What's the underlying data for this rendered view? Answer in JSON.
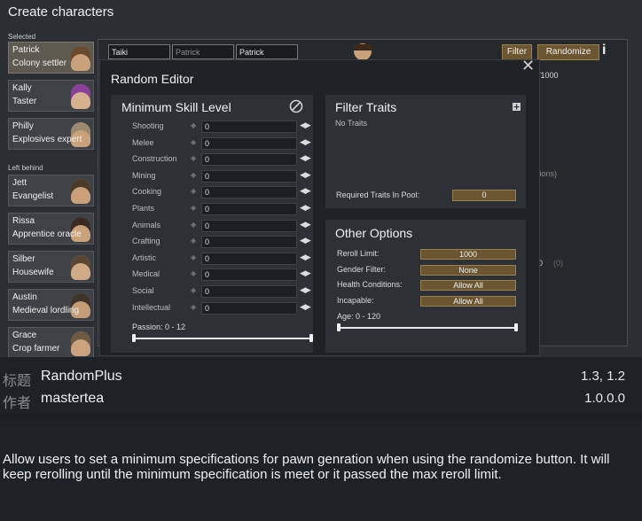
{
  "window": {
    "title": "Create characters"
  },
  "sections": {
    "selected": "Selected",
    "left_behind": "Left behind"
  },
  "pawns_selected": [
    {
      "name": "Patrick",
      "title": "Colony settler",
      "hair": "#6a4a2e",
      "skin": "#c9a27c"
    },
    {
      "name": "Kally",
      "title": "Taster",
      "hair": "#8a3f9a",
      "skin": "#d7b090"
    },
    {
      "name": "Philly",
      "title": "Explosives expert",
      "hair": "#9a8a70",
      "skin": "#c9a27c"
    }
  ],
  "pawns_left": [
    {
      "name": "Jett",
      "title": "Evangelist",
      "hair": "#4a3a2a",
      "skin": "#caa07a"
    },
    {
      "name": "Rissa",
      "title": "Apprentice oracle",
      "hair": "#3a2a22",
      "skin": "#c9a27c"
    },
    {
      "name": "Silber",
      "title": "Housewife",
      "hair": "#5a4632",
      "skin": "#d0aa86"
    },
    {
      "name": "Austin",
      "title": "Medieval lordling",
      "hair": "#3e342a",
      "skin": "#c49c76"
    },
    {
      "name": "Grace",
      "title": "Crop farmer",
      "hair": "#6e5a40",
      "skin": "#caa27e"
    }
  ],
  "name_fields": [
    "Taiki",
    "Patrick",
    "Patrick"
  ],
  "toolbar": {
    "filter_label": "Filter",
    "randomize_label": "Randomize",
    "info_icon": "info-icon"
  },
  "background_fragments": {
    "counter": "/1000",
    "options": "tions)",
    "zero": "0",
    "paren_zero": "(0)"
  },
  "dialog": {
    "title": "Random Editor",
    "min_skill": {
      "title": "Minimum Skill Level",
      "skills": [
        {
          "label": "Shooting",
          "value": "0"
        },
        {
          "label": "Melee",
          "value": "0"
        },
        {
          "label": "Construction",
          "value": "0"
        },
        {
          "label": "Mining",
          "value": "0"
        },
        {
          "label": "Cooking",
          "value": "0"
        },
        {
          "label": "Plants",
          "value": "0"
        },
        {
          "label": "Animals",
          "value": "0"
        },
        {
          "label": "Crafting",
          "value": "0"
        },
        {
          "label": "Artistic",
          "value": "0"
        },
        {
          "label": "Medical",
          "value": "0"
        },
        {
          "label": "Social",
          "value": "0"
        },
        {
          "label": "Intellectual",
          "value": "0"
        }
      ],
      "passion_label": "Passion: 0 - 12",
      "passion_min": 0,
      "passion_max": 12
    },
    "filter_traits": {
      "title": "Filter Traits",
      "no_traits": "No Traits",
      "required_label": "Required Traits In Pool:",
      "required_value": "0"
    },
    "other_options": {
      "title": "Other Options",
      "rows": [
        {
          "label": "Reroll Limit:",
          "value": "1000"
        },
        {
          "label": "Gender Filter:",
          "value": "None"
        },
        {
          "label": "Health Conditions:",
          "value": "Allow All"
        },
        {
          "label": "Incapable:",
          "value": "Allow All"
        }
      ],
      "age_label": "Age: 0 - 120",
      "age_min": 0,
      "age_max": 120
    }
  },
  "mod_info": {
    "title_key": "标题",
    "title_value": "RandomPlus",
    "versions": "1.3, 1.2",
    "author_key": "作者",
    "author_value": "mastertea",
    "mod_version": "1.0.0.0"
  },
  "description": "Allow users to set a minimum specifications for pawn genration when using the randomize button. It will keep rerolling until the minimum specification is meet or it passed the max reroll limit."
}
